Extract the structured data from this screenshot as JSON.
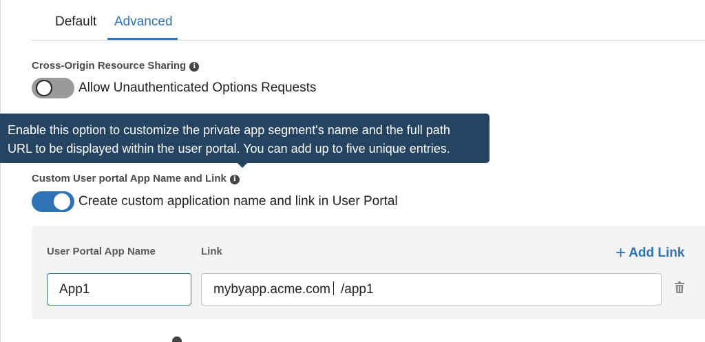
{
  "tabs": [
    {
      "label": "Default",
      "active": false
    },
    {
      "label": "Advanced",
      "active": true
    }
  ],
  "cors": {
    "label": "Cross-Origin Resource Sharing",
    "toggle_on": false,
    "toggle_label": "Allow Unauthenticated Options Requests"
  },
  "tooltip": {
    "line1": "Enable this option to customize the private app segment's name and the full path",
    "line2": "URL to be displayed within the user portal. You can add up to five unique entries."
  },
  "custom_portal": {
    "label": "Custom User portal App Name and Link",
    "toggle_on": true,
    "toggle_label": "Create custom application name and link in User Portal",
    "columns": {
      "name": "User Portal App Name",
      "link": "Link"
    },
    "add_link_label": "Add Link",
    "rows": [
      {
        "app_name": "App1",
        "domain": "mybyapp.acme.com",
        "path": "/app1"
      }
    ]
  },
  "icons": {
    "info": "info-icon",
    "plus": "plus-icon",
    "delete": "trash-icon"
  },
  "colors": {
    "accent": "#2e74b5",
    "tooltip_bg": "#244461",
    "toggle_off": "#9a9a9a",
    "panel_bg": "#f4f4f4"
  }
}
